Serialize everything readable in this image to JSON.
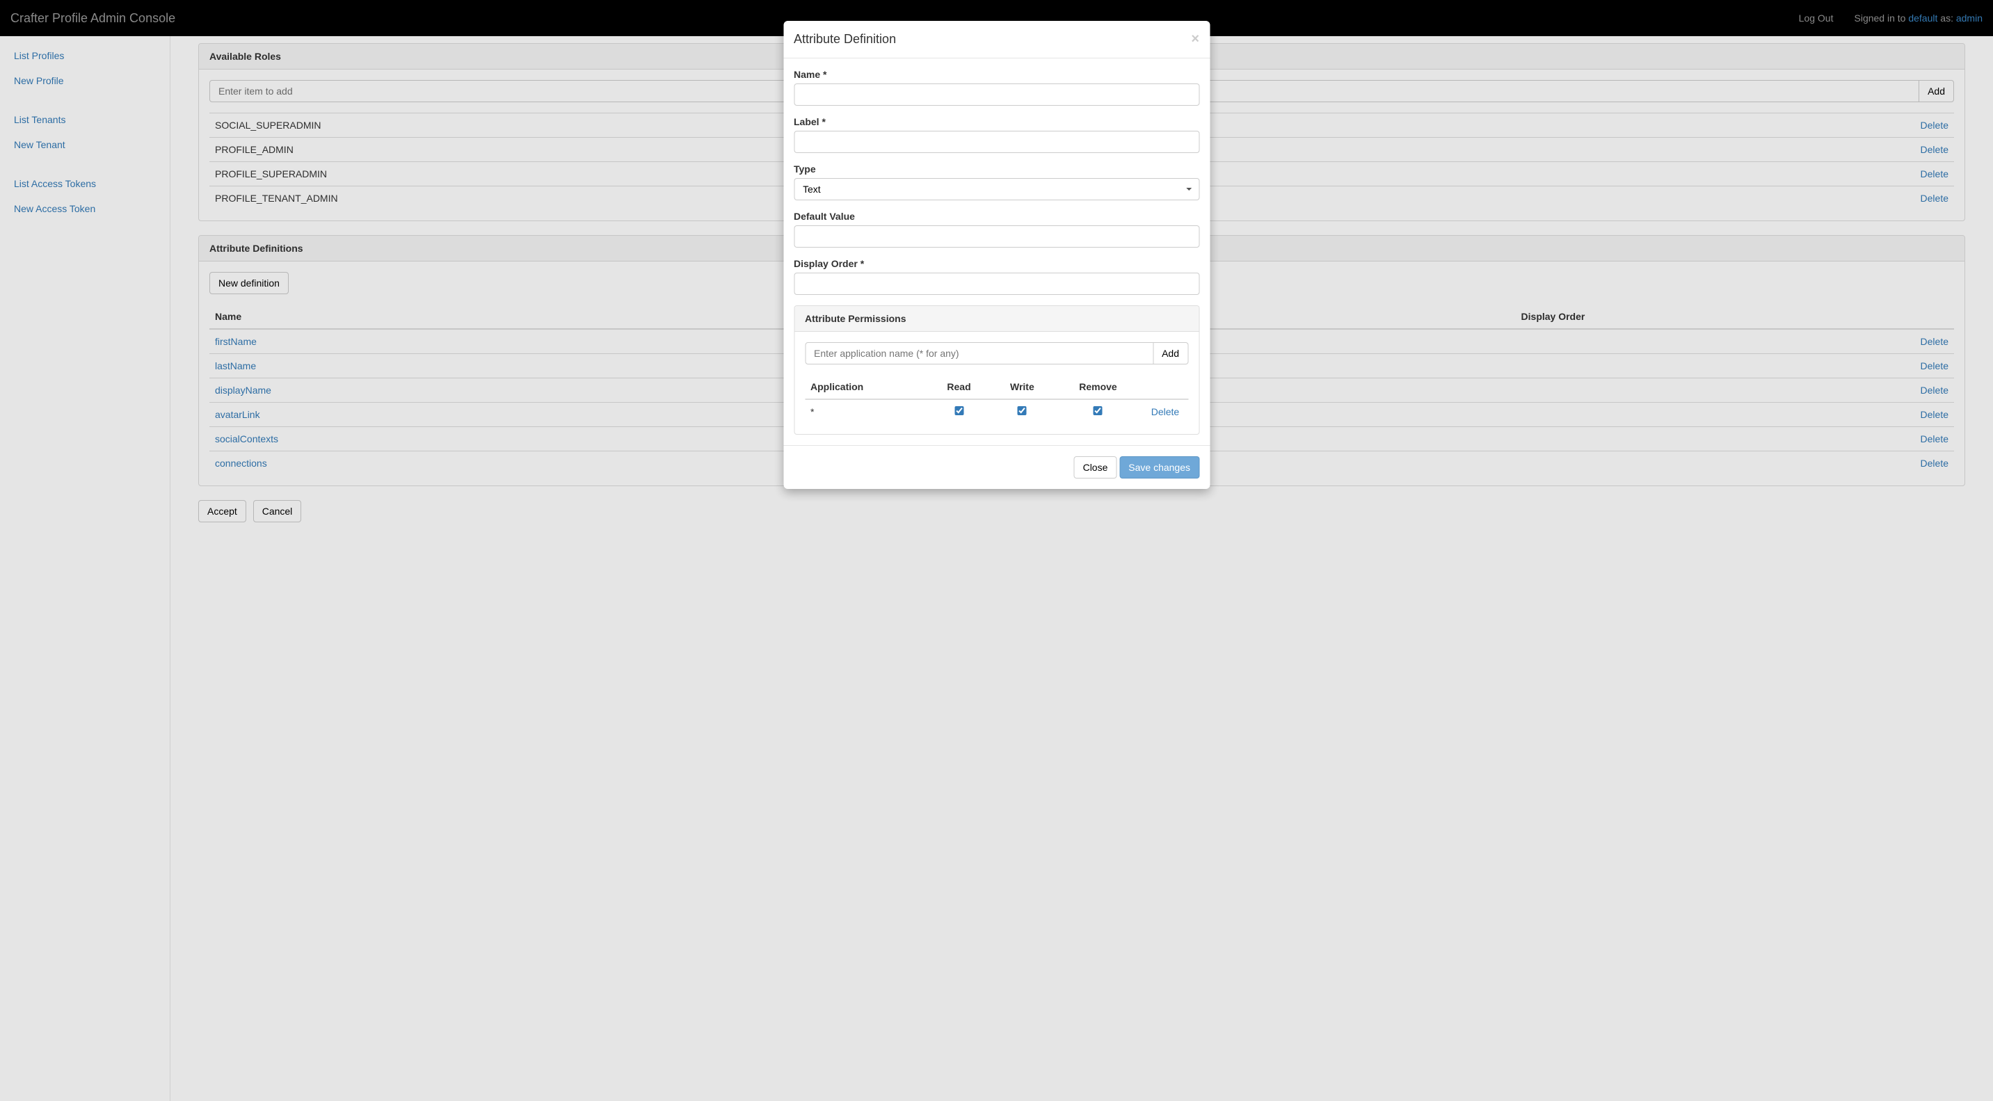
{
  "navbar": {
    "brand": "Crafter Profile Admin Console",
    "logout": "Log Out",
    "signed_in_prefix": "Signed in to ",
    "tenant_link": "default",
    "as_text": " as: ",
    "user_link": "admin"
  },
  "sidebar": {
    "group1": [
      {
        "label": "List Profiles"
      },
      {
        "label": "New Profile"
      }
    ],
    "group2": [
      {
        "label": "List Tenants"
      },
      {
        "label": "New Tenant"
      }
    ],
    "group3": [
      {
        "label": "List Access Tokens"
      },
      {
        "label": "New Access Token"
      }
    ]
  },
  "roles_panel": {
    "title": "Available Roles",
    "input_placeholder": "Enter item to add",
    "add_label": "Add",
    "rows": [
      {
        "name": "SOCIAL_SUPERADMIN",
        "action": "Delete"
      },
      {
        "name": "PROFILE_ADMIN",
        "action": "Delete"
      },
      {
        "name": "PROFILE_SUPERADMIN",
        "action": "Delete"
      },
      {
        "name": "PROFILE_TENANT_ADMIN",
        "action": "Delete"
      }
    ]
  },
  "attr_panel": {
    "title": "Attribute Definitions",
    "new_def_label": "New definition",
    "headers": {
      "name": "Name",
      "display_order": "Display Order"
    },
    "rows": [
      {
        "name": "firstName",
        "action": "Delete"
      },
      {
        "name": "lastName",
        "action": "Delete"
      },
      {
        "name": "displayName",
        "action": "Delete"
      },
      {
        "name": "avatarLink",
        "action": "Delete"
      },
      {
        "name": "socialContexts",
        "action": "Delete"
      },
      {
        "name": "connections",
        "action": "Delete"
      }
    ]
  },
  "form_actions": {
    "accept": "Accept",
    "cancel": "Cancel"
  },
  "modal": {
    "title": "Attribute Definition",
    "labels": {
      "name": "Name *",
      "label": "Label *",
      "type": "Type",
      "default_value": "Default Value",
      "display_order": "Display Order *"
    },
    "type_value": "Text",
    "permissions": {
      "title": "Attribute Permissions",
      "input_placeholder": "Enter application name (* for any)",
      "add_label": "Add",
      "headers": {
        "application": "Application",
        "read": "Read",
        "write": "Write",
        "remove": "Remove"
      },
      "rows": [
        {
          "application": "*",
          "read": true,
          "write": true,
          "remove": true,
          "action": "Delete"
        }
      ]
    },
    "footer": {
      "close": "Close",
      "save": "Save changes"
    }
  }
}
